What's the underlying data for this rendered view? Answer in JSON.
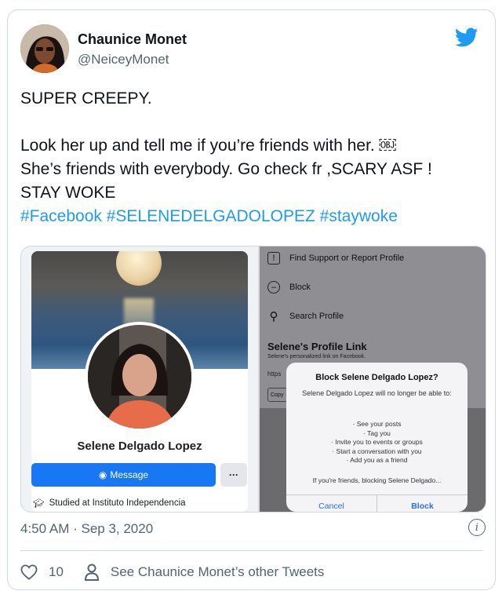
{
  "tweet": {
    "author_name": "Chaunice Monet",
    "author_handle": "@NeiceyMonet",
    "line1": "SUPER CREEPY.",
    "line2": "Look her up and tell me if you’re friends with her. ￼",
    "line3": "She’s friends with everybody. Go check fr ,SCARY ASF !",
    "line4": "STAY WOKE",
    "hashtags": "#Facebook #SELENEDELGADOLOPEZ #staywoke",
    "timestamp": "4:50 AM · Sep 3, 2020",
    "likes": "10",
    "other_tweets": "See Chaunice Monet’s other Tweets"
  },
  "media": {
    "profile_name": "Selene Delgado Lopez",
    "message_label": "Message",
    "more_label": "···",
    "studied": "Studied at Instituto Independencia",
    "menu": {
      "find_support": "Find Support or Report Profile",
      "block": "Block",
      "search_profile": "Search Profile",
      "link_title": "Selene's Profile Link",
      "link_sub": "Selene's personalized link on Facebook.",
      "https": "https",
      "copy": "Copy"
    },
    "dialog": {
      "title": "Block Selene Delgado Lopez?",
      "desc": "Selene Delgado Lopez will no longer be able to:",
      "item1": "· See your posts",
      "item2": "· Tag you",
      "item3": "· Invite you to events or groups",
      "item4": "· Start a conversation with you",
      "item5": "· Add you as a friend",
      "footer": "If you're friends, blocking Selene Delgado...",
      "cancel": "Cancel",
      "block": "Block"
    }
  },
  "colors": {
    "link_blue": "#1d9bf0",
    "fb_blue": "#1877f2",
    "muted": "#536471"
  }
}
